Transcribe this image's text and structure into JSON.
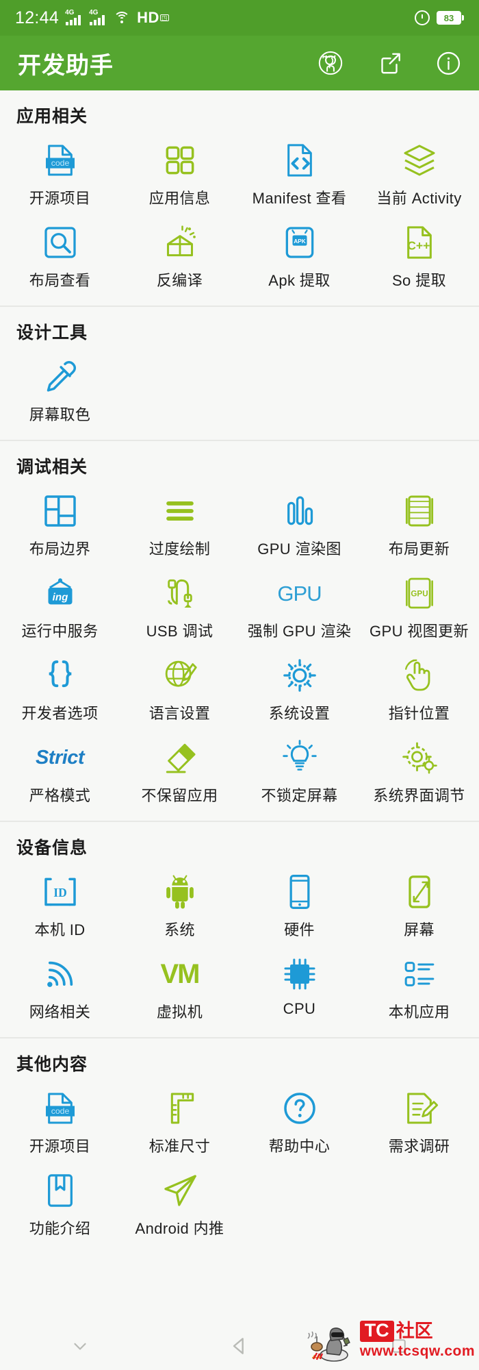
{
  "statusbar": {
    "time": "12:44",
    "network_label_1": "4G",
    "network_label_2": "4G",
    "wifi_icon": "wifi-icon",
    "hd_label": "HD",
    "volte_label": "",
    "alarm_icon": "alarm-clock-icon",
    "battery_level": "83"
  },
  "appbar": {
    "title": "开发助手",
    "actions": [
      {
        "name": "github-icon",
        "label": "GitHub"
      },
      {
        "name": "share-icon",
        "label": "分享"
      },
      {
        "name": "info-icon",
        "label": "关于"
      }
    ]
  },
  "sections": [
    {
      "title": "应用相关",
      "items": [
        {
          "label": "开源项目",
          "icon": "code-file-icon"
        },
        {
          "label": "应用信息",
          "icon": "app-grid-icon"
        },
        {
          "label": "Manifest 查看",
          "icon": "code-document-icon"
        },
        {
          "label": "当前 Activity",
          "icon": "layers-icon"
        },
        {
          "label": "布局查看",
          "icon": "layout-search-icon"
        },
        {
          "label": "反编译",
          "icon": "open-box-icon"
        },
        {
          "label": "Apk 提取",
          "icon": "apk-icon"
        },
        {
          "label": "So 提取",
          "icon": "cpp-file-icon"
        }
      ]
    },
    {
      "title": "设计工具",
      "items": [
        {
          "label": "屏幕取色",
          "icon": "eyedropper-icon"
        }
      ]
    },
    {
      "title": "调试相关",
      "items": [
        {
          "label": "布局边界",
          "icon": "layout-bounds-icon"
        },
        {
          "label": "过度绘制",
          "icon": "overdraw-lines-icon"
        },
        {
          "label": "GPU 渲染图",
          "icon": "bar-chart-icon"
        },
        {
          "label": "布局更新",
          "icon": "layout-update-icon"
        },
        {
          "label": "运行中服务",
          "icon": "running-sign-icon"
        },
        {
          "label": "USB 调试",
          "icon": "usb-cable-icon"
        },
        {
          "label": "强制 GPU 渲染",
          "icon": "gpu-text-icon"
        },
        {
          "label": "GPU 视图更新",
          "icon": "gpu-view-update-icon"
        },
        {
          "label": "开发者选项",
          "icon": "braces-icon"
        },
        {
          "label": "语言设置",
          "icon": "globe-pencil-icon"
        },
        {
          "label": "系统设置",
          "icon": "gear-icon"
        },
        {
          "label": "指针位置",
          "icon": "pointer-touch-icon"
        },
        {
          "label": "严格模式",
          "icon": "strict-text-icon"
        },
        {
          "label": "不保留应用",
          "icon": "eraser-icon"
        },
        {
          "label": "不锁定屏幕",
          "icon": "lightbulb-icon"
        },
        {
          "label": "系统界面调节",
          "icon": "gear-tune-icon"
        }
      ]
    },
    {
      "title": "设备信息",
      "items": [
        {
          "label": "本机 ID",
          "icon": "id-badge-icon"
        },
        {
          "label": "系统",
          "icon": "android-robot-icon"
        },
        {
          "label": "硬件",
          "icon": "phone-icon"
        },
        {
          "label": "屏幕",
          "icon": "screen-icon"
        },
        {
          "label": "网络相关",
          "icon": "signal-wave-icon"
        },
        {
          "label": "虚拟机",
          "icon": "vm-text-icon"
        },
        {
          "label": "CPU",
          "icon": "cpu-chip-icon"
        },
        {
          "label": "本机应用",
          "icon": "app-list-icon"
        }
      ]
    },
    {
      "title": "其他内容",
      "items": [
        {
          "label": "开源项目",
          "icon": "code-file-icon"
        },
        {
          "label": "标准尺寸",
          "icon": "ruler-icon"
        },
        {
          "label": "帮助中心",
          "icon": "question-circle-icon"
        },
        {
          "label": "需求调研",
          "icon": "survey-pencil-icon"
        },
        {
          "label": "功能介绍",
          "icon": "bookmark-book-icon"
        },
        {
          "label": "Android 内推",
          "icon": "paper-plane-icon"
        }
      ]
    }
  ],
  "navbar": {
    "buttons": [
      {
        "name": "hide-keyboard-icon",
        "label": "收起"
      },
      {
        "name": "back-icon",
        "label": "返回"
      },
      {
        "name": "recents-icon",
        "label": "多任务"
      }
    ]
  },
  "watermark": {
    "brand": "TC",
    "brand_suffix": "社区",
    "url": "www.tcsqw.com"
  },
  "colors": {
    "statusbar_green": "#4f9e2a",
    "appbar_green": "#55a630",
    "icon_blue": "#1e9ad6",
    "icon_green": "#96c11f",
    "page_bg": "#f7f8f6",
    "text_dark": "#1f1f1f",
    "watermark_red": "#e11b22"
  }
}
